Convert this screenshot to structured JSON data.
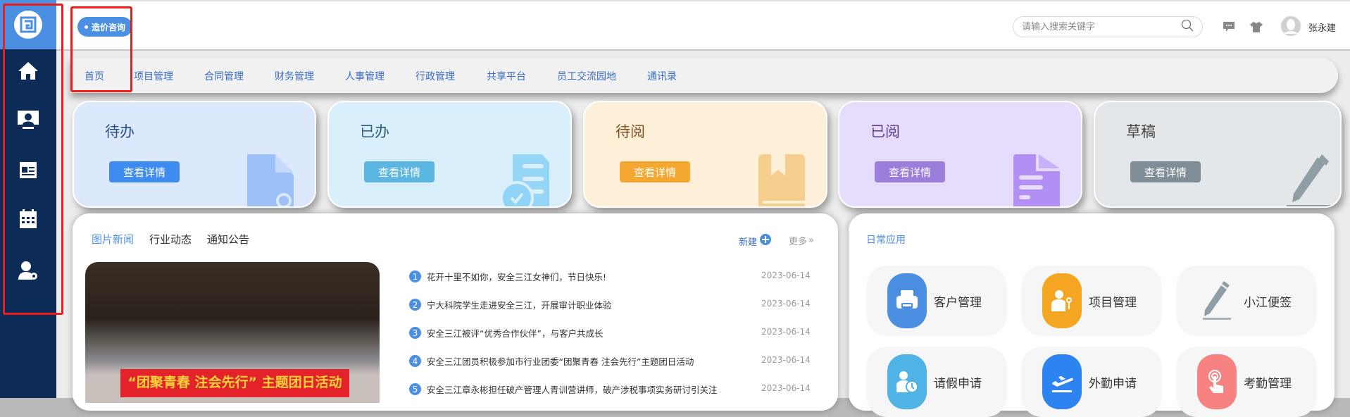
{
  "header": {
    "badge": "造价咨询",
    "search_placeholder": "请输入搜索关键字",
    "user_name": "张永建"
  },
  "nav": [
    "首页",
    "项目管理",
    "合同管理",
    "财务管理",
    "人事管理",
    "行政管理",
    "共享平台",
    "员工交流园地",
    "通讯录"
  ],
  "cards": [
    {
      "title": "待办",
      "button": "查看详情",
      "bg": "#dce8fb",
      "btn": "#3f8cf0",
      "title_color": "#2b4f86"
    },
    {
      "title": "已办",
      "button": "查看详情",
      "bg": "#d9f0fc",
      "btn": "#5cb6e2",
      "title_color": "#2e5c78"
    },
    {
      "title": "待阅",
      "button": "查看详情",
      "bg": "#fdefd8",
      "btn": "#f4a731",
      "title_color": "#7a5424"
    },
    {
      "title": "已阅",
      "button": "查看详情",
      "bg": "#e6dcfb",
      "btn": "#9b7ddc",
      "title_color": "#5a3c8a"
    },
    {
      "title": "草稿",
      "button": "查看详情",
      "bg": "#e3e7ea",
      "btn": "#7f8e96",
      "title_color": "#444"
    }
  ],
  "news": {
    "tabs": [
      "图片新闻",
      "行业动态",
      "通知公告"
    ],
    "new_label": "新建",
    "more_label": "更多",
    "photo_banner": "“团聚青春 注会先行” 主题团日活动",
    "items": [
      {
        "n": "1",
        "title": "花开十里不如你，安全三江女神们，节日快乐!",
        "date": "2023-06-14"
      },
      {
        "n": "2",
        "title": "宁大科院学生走进安全三江，开展审计职业体验",
        "date": "2023-06-14"
      },
      {
        "n": "3",
        "title": "安全三江被评“优秀合作伙伴”，与客户共成长",
        "date": "2023-06-14"
      },
      {
        "n": "4",
        "title": "安全三江团员积极参加市行业团委“团聚青春 注会先行”主题团日活动",
        "date": "2023-06-14"
      },
      {
        "n": "5",
        "title": "安全三江章永彬担任破产管理人青训营讲师，破产涉税事项实务研讨引关注",
        "date": "2023-06-14"
      }
    ]
  },
  "apps": {
    "title": "日常应用",
    "items": [
      {
        "label": "客户管理",
        "color": "#4a8fe2"
      },
      {
        "label": "项目管理",
        "color": "#f4a623"
      },
      {
        "label": "小江便签",
        "color": "transparent"
      },
      {
        "label": "请假申请",
        "color": "#4fb3e6"
      },
      {
        "label": "外勤申请",
        "color": "#2d84f0"
      },
      {
        "label": "考勤管理",
        "color": "#f78282"
      }
    ]
  }
}
